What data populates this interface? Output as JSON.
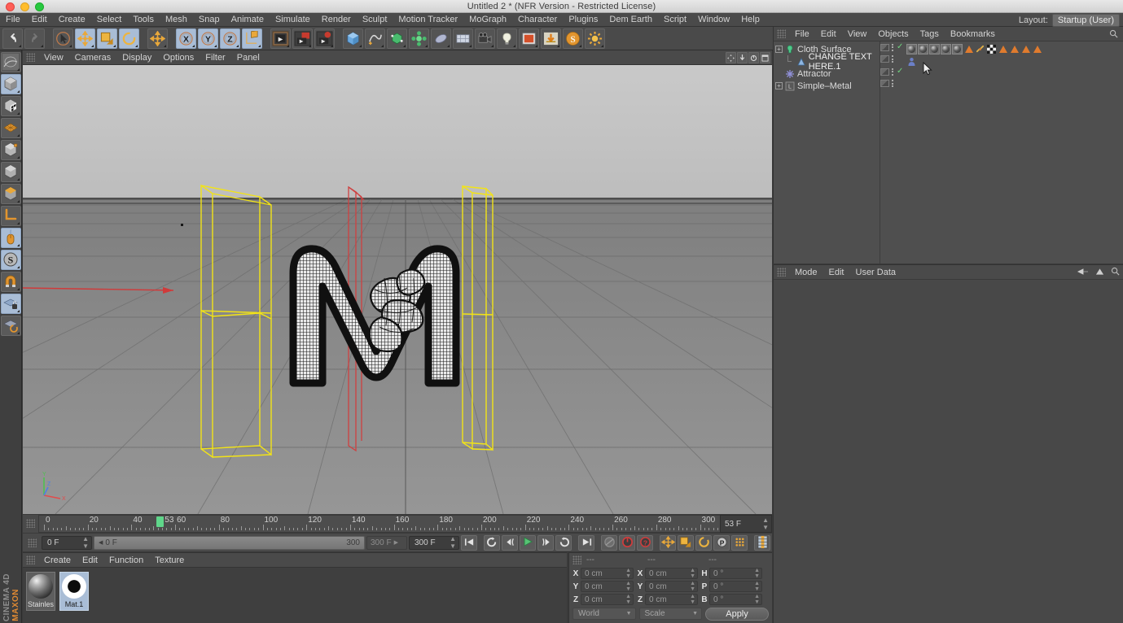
{
  "window": {
    "title": "Untitled 2 * (NFR Version - Restricted License)"
  },
  "menubar": {
    "items": [
      "File",
      "Edit",
      "Create",
      "Select",
      "Tools",
      "Mesh",
      "Snap",
      "Animate",
      "Simulate",
      "Render",
      "Sculpt",
      "Motion Tracker",
      "MoGraph",
      "Character",
      "Plugins",
      "Dem Earth",
      "Script",
      "Window",
      "Help"
    ],
    "layout_label": "Layout:",
    "layout_value": "Startup (User)"
  },
  "toolbar": {
    "groups": [
      {
        "buttons": [
          {
            "name": "undo-button",
            "icon": "↶",
            "style": "dark"
          },
          {
            "name": "redo-button",
            "icon": "↷",
            "style": "dark"
          }
        ]
      },
      {
        "buttons": [
          {
            "name": "live-selection-tool",
            "icon": "select",
            "style": "dark"
          },
          {
            "name": "move-tool",
            "icon": "move",
            "style": "lite"
          },
          {
            "name": "scale-tool",
            "icon": "scale",
            "style": "lite"
          },
          {
            "name": "rotate-tool",
            "icon": "rotate",
            "style": "lite"
          }
        ]
      },
      {
        "buttons": [
          {
            "name": "move-axis-tool",
            "icon": "move",
            "style": "dark"
          }
        ]
      },
      {
        "buttons": [
          {
            "name": "x-axis-lock-button",
            "icon": "X",
            "style": "lite"
          },
          {
            "name": "y-axis-lock-button",
            "icon": "Y",
            "style": "lite"
          },
          {
            "name": "z-axis-lock-button",
            "icon": "Z",
            "style": "lite"
          },
          {
            "name": "world-object-coordinate-button",
            "icon": "coord",
            "style": "lite"
          }
        ]
      },
      {
        "buttons": [
          {
            "name": "render-view-button",
            "icon": "render-view",
            "style": "dark"
          },
          {
            "name": "render-region-button",
            "icon": "render-region",
            "style": "dark"
          },
          {
            "name": "render-settings-button",
            "icon": "render-settings",
            "style": "dark"
          }
        ]
      },
      {
        "buttons": [
          {
            "name": "add-cube-button",
            "icon": "cube",
            "style": "dark"
          },
          {
            "name": "add-spline-button",
            "icon": "spline",
            "style": "dark"
          },
          {
            "name": "add-nurbs-button",
            "icon": "nurbs",
            "style": "dark"
          },
          {
            "name": "add-array-button",
            "icon": "array",
            "style": "dark"
          },
          {
            "name": "add-deformer-button",
            "icon": "deformer",
            "style": "dark"
          },
          {
            "name": "add-scene-button",
            "icon": "scene",
            "style": "dark"
          },
          {
            "name": "add-camera-button",
            "icon": "camera",
            "style": "dark"
          },
          {
            "name": "add-light-button",
            "icon": "light",
            "style": "dark"
          },
          {
            "name": "add-material-button",
            "icon": "material",
            "style": "dark"
          },
          {
            "name": "content-browser-button",
            "icon": "browser",
            "style": "dark"
          },
          {
            "name": "sculpt-button",
            "icon": "sculpt",
            "style": "dark"
          },
          {
            "name": "simulate-button",
            "icon": "simulate",
            "style": "dark"
          }
        ]
      }
    ]
  },
  "left_toolbar": {
    "buttons": [
      {
        "name": "texture-axis-tool",
        "icon": "texture"
      },
      {
        "name": "model-mode-button",
        "icon": "cube-gray",
        "style": "lite"
      },
      {
        "name": "texture-mode-button",
        "icon": "cube-checker"
      },
      {
        "name": "points-mode-button",
        "icon": "points-grid"
      },
      {
        "name": "edges-mode-button",
        "icon": "cube-edges"
      },
      {
        "name": "polygons-mode-button",
        "icon": "cube-poly"
      },
      {
        "name": "object-axis-mode-button",
        "icon": "cube-orange"
      },
      {
        "name": "axis-modify-button",
        "icon": "axis-L"
      },
      {
        "name": "viewport-solo-button",
        "icon": "mouse",
        "style": "lite"
      },
      {
        "name": "enable-snap-button",
        "icon": "S-circle",
        "style": "lite"
      },
      {
        "name": "magnet-tool-button",
        "icon": "magnet"
      },
      {
        "name": "workplane-lock-button",
        "icon": "plane-lock",
        "style": "lite"
      },
      {
        "name": "workplane-rotate-button",
        "icon": "plane-rotate"
      }
    ],
    "brand_top": "MAXON",
    "brand_bottom": "CINEMA 4D"
  },
  "viewport": {
    "menus": [
      "View",
      "Cameras",
      "Display",
      "Options",
      "Filter",
      "Panel"
    ],
    "controls": [
      "pan-icon",
      "zoom-icon",
      "rotate-icon",
      "maximize-icon"
    ],
    "axis": {
      "x": "X",
      "y": "Y",
      "z": "Z"
    }
  },
  "timeline": {
    "tick_labels": [
      "0",
      "20",
      "40",
      "60",
      "80",
      "100",
      "120",
      "140",
      "160",
      "180",
      "200",
      "220",
      "240",
      "260",
      "280",
      "300"
    ],
    "playhead_frame": "53",
    "frame_field": "53 F",
    "start_field": "0 F",
    "range_start": "0 F",
    "range_end": "300",
    "end_ghost": "300 F",
    "end_field": "300 F"
  },
  "playback": {
    "buttons": [
      {
        "name": "go-to-start-button",
        "icon": "|◀"
      },
      {
        "name": "previous-keyframe-button",
        "icon": "↺"
      },
      {
        "name": "step-back-button",
        "icon": "◀|"
      },
      {
        "name": "play-button",
        "icon": "▶"
      },
      {
        "name": "step-forward-button",
        "icon": "|▶"
      },
      {
        "name": "next-keyframe-button",
        "icon": "↻"
      },
      {
        "name": "go-to-end-button",
        "icon": "▶|"
      },
      {
        "name": "record-active-objects-button",
        "icon": "rec-gray"
      },
      {
        "name": "autokeying-button",
        "icon": "rec-red"
      },
      {
        "name": "keyframe-selection-button",
        "icon": "question-red"
      },
      {
        "name": "position-key-button",
        "icon": "move-key"
      },
      {
        "name": "scale-key-button",
        "icon": "scale-key"
      },
      {
        "name": "rotation-key-button",
        "icon": "rotate-key"
      },
      {
        "name": "parameter-key-button",
        "icon": "P-key"
      },
      {
        "name": "point-level-animation-button",
        "icon": "pla-dots"
      },
      {
        "name": "timeline-mode-button",
        "icon": "timeline-strip"
      }
    ]
  },
  "material_manager": {
    "menus": [
      "Create",
      "Edit",
      "Function",
      "Texture"
    ],
    "materials": [
      {
        "name": "Stainles",
        "selected": false
      },
      {
        "name": "Mat.1",
        "selected": true
      }
    ]
  },
  "coordinates": {
    "headers": [
      "---",
      "---",
      "---"
    ],
    "rows": [
      {
        "ax1": "X",
        "v1": "0 cm",
        "ax2": "X",
        "v2": "0 cm",
        "ax3": "H",
        "v3": "0 °"
      },
      {
        "ax1": "Y",
        "v1": "0 cm",
        "ax2": "Y",
        "v2": "0 cm",
        "ax3": "P",
        "v3": "0 °"
      },
      {
        "ax1": "Z",
        "v1": "0 cm",
        "ax2": "Z",
        "v2": "0 cm",
        "ax3": "B",
        "v3": "0 °"
      }
    ],
    "system": "World",
    "mode": "Scale",
    "apply": "Apply"
  },
  "object_manager": {
    "menus": [
      "File",
      "Edit",
      "View",
      "Objects",
      "Tags",
      "Bookmarks"
    ],
    "objects": [
      {
        "name": "Cloth Surface",
        "icon": "cloth-surface-icon",
        "indent": 0,
        "expander": "+",
        "check": true,
        "tags": [
          {
            "type": "sphere"
          },
          {
            "type": "sphere"
          },
          {
            "type": "sphere"
          },
          {
            "type": "sphere"
          },
          {
            "type": "sphere"
          },
          {
            "type": "triangle"
          },
          {
            "type": "link"
          },
          {
            "type": "checker"
          },
          {
            "type": "triangle"
          },
          {
            "type": "triangle"
          },
          {
            "type": "triangle"
          },
          {
            "type": "triangle"
          }
        ]
      },
      {
        "name": "CHANGE TEXT HERE.1",
        "icon": "text-spline-icon",
        "indent": 1,
        "expander": "",
        "check": false,
        "tags": [
          {
            "type": "person"
          }
        ]
      },
      {
        "name": "Attractor",
        "icon": "attractor-icon",
        "indent": 0,
        "expander": "",
        "check": true,
        "tags": []
      },
      {
        "name": "Simple–Metal",
        "icon": "material-icon",
        "indent": 0,
        "expander": "+",
        "check": false,
        "tags": []
      }
    ]
  },
  "attribute_manager": {
    "menus": [
      "Mode",
      "Edit",
      "User Data"
    ],
    "icons": [
      "back-arrow-icon",
      "forward-arrow-icon",
      "up-arrow-icon",
      "search-icon"
    ]
  }
}
